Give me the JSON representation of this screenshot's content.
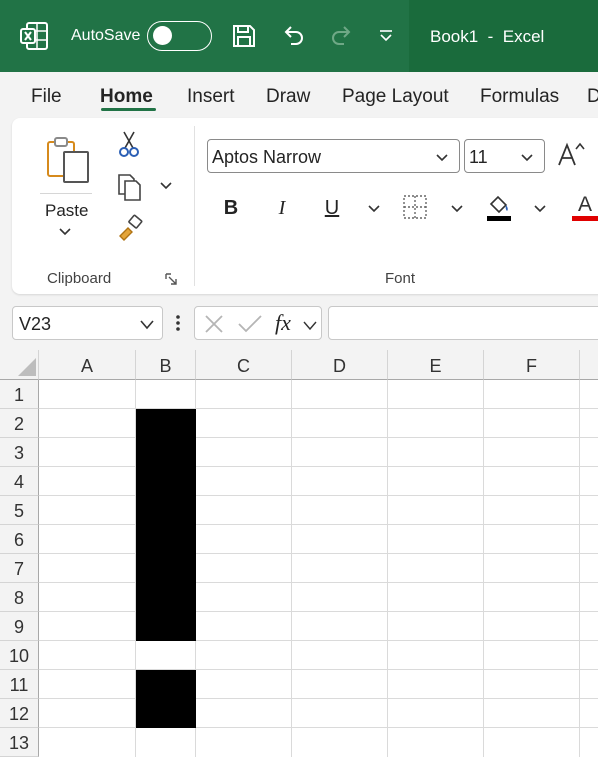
{
  "titlebar": {
    "autosave_label": "AutoSave",
    "autosave_state": "off",
    "document_title": "Book1  -  Excel",
    "brand_color": "#217346",
    "icons": [
      "excel-app-icon",
      "save-icon",
      "undo-icon",
      "redo-icon",
      "customize-qat-icon"
    ]
  },
  "menu": {
    "tabs": [
      "File",
      "Home",
      "Insert",
      "Draw",
      "Page Layout",
      "Formulas",
      "D"
    ],
    "active_tab": "Home"
  },
  "ribbon": {
    "clipboard": {
      "paste_label": "Paste",
      "group_label": "Clipboard",
      "icons": [
        "paste-icon",
        "cut-icon",
        "copy-icon",
        "format-painter-icon",
        "dialog-launcher-icon"
      ]
    },
    "font": {
      "font_name": "Aptos Narrow",
      "font_size": "11",
      "group_label": "Font",
      "bold": "B",
      "italic": "I",
      "underline": "U",
      "font_color_glyph": "A",
      "fill_color": "#000000",
      "font_color": "#e00000",
      "icons": [
        "increase-font-size-icon",
        "borders-icon",
        "fill-color-icon",
        "font-color-icon"
      ]
    }
  },
  "formula_bar": {
    "name_box": "V23",
    "fx_label": "fx",
    "formula_value": ""
  },
  "sheet": {
    "columns": [
      "A",
      "B",
      "C",
      "D",
      "E",
      "F"
    ],
    "rows": [
      "1",
      "2",
      "3",
      "4",
      "5",
      "6",
      "7",
      "8",
      "9",
      "10",
      "11",
      "12",
      "13"
    ],
    "filled_cells": {
      "column": "B",
      "rows": [
        "2",
        "3",
        "4",
        "5",
        "6",
        "7",
        "8",
        "9",
        "11",
        "12"
      ],
      "color": "#000000"
    }
  }
}
